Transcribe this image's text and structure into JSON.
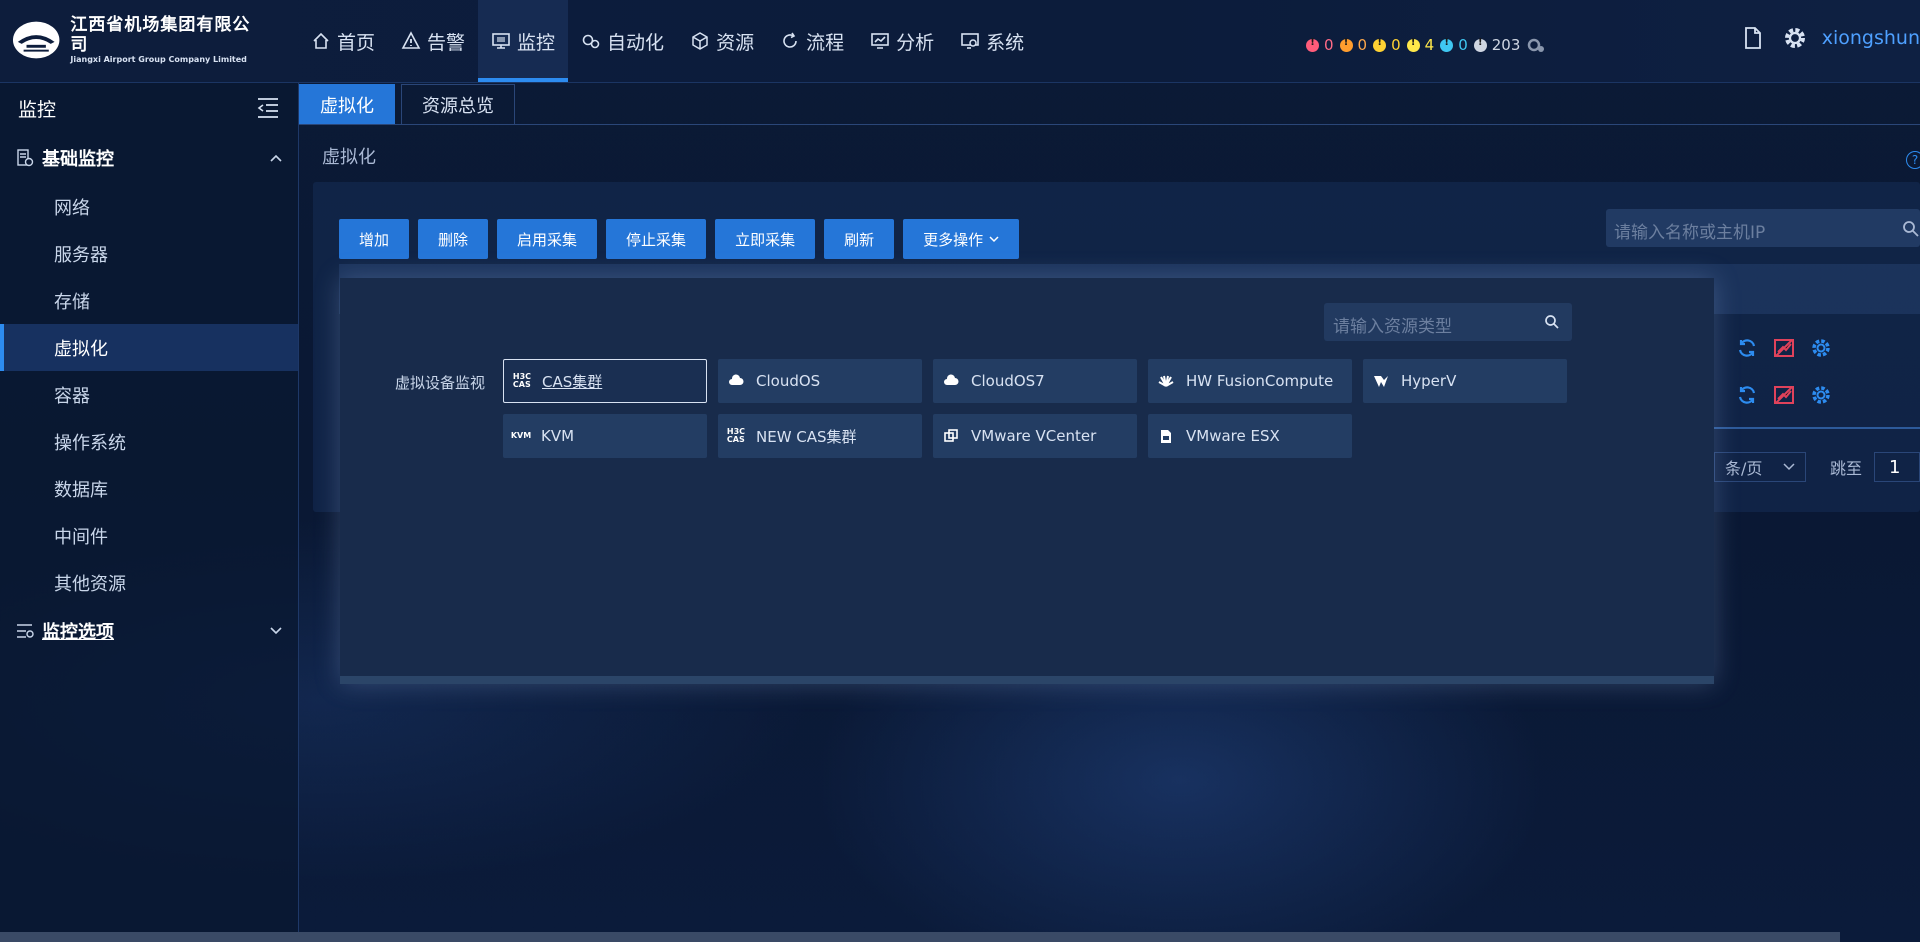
{
  "logo": {
    "cn": "江西省机场集团有限公司",
    "en": "Jiangxi Airport Group Company Limited"
  },
  "nav": [
    {
      "label": "首页",
      "icon": "home-icon"
    },
    {
      "label": "告警",
      "icon": "warning-icon"
    },
    {
      "label": "监控",
      "icon": "monitor-icon",
      "active": true
    },
    {
      "label": "自动化",
      "icon": "gears-icon"
    },
    {
      "label": "资源",
      "icon": "cube-icon"
    },
    {
      "label": "流程",
      "icon": "refresh-icon"
    },
    {
      "label": "分析",
      "icon": "chart-icon"
    },
    {
      "label": "系统",
      "icon": "settings-screen-icon"
    }
  ],
  "alerts": [
    {
      "count": "0",
      "color": "#ff5c7a"
    },
    {
      "count": "0",
      "color": "#ff9d2e"
    },
    {
      "count": "0",
      "color": "#ffd233"
    },
    {
      "count": "4",
      "color": "#ffe84a"
    },
    {
      "count": "0",
      "color": "#3fc8f2"
    },
    {
      "count": "203",
      "color": "#cfd6e2"
    }
  ],
  "user": {
    "name": "xiongshun"
  },
  "sidebar": {
    "title": "监控",
    "group1": "基础监控",
    "items": [
      "网络",
      "服务器",
      "存储",
      "虚拟化",
      "容器",
      "操作系统",
      "数据库",
      "中间件",
      "其他资源"
    ],
    "active_index": 3,
    "group2": "监控选项"
  },
  "tabs": [
    {
      "label": "虚拟化",
      "active": true
    },
    {
      "label": "资源总览",
      "active": false
    }
  ],
  "page": {
    "title": "虚拟化"
  },
  "toolbar": [
    "增加",
    "删除",
    "启用采集",
    "停止采集",
    "立即采集",
    "刷新",
    "更多操作"
  ],
  "search": {
    "placeholder": "请输入名称或主机IP"
  },
  "pager": {
    "per_page": "条/页",
    "jump": "跳至",
    "page": "1"
  },
  "modal": {
    "search_placeholder": "请输入资源类型",
    "category": "虚拟设备监视",
    "resources": [
      {
        "label": "CAS集群",
        "icon": "h3c-cas-icon",
        "selected": true
      },
      {
        "label": "CloudOS",
        "icon": "cloud-os-icon"
      },
      {
        "label": "CloudOS7",
        "icon": "cloud-os-icon"
      },
      {
        "label": "HW FusionCompute",
        "icon": "huawei-icon"
      },
      {
        "label": "HyperV",
        "icon": "hyperv-icon"
      },
      {
        "label": "KVM",
        "icon": "kvm-icon"
      },
      {
        "label": "NEW CAS集群",
        "icon": "h3c-cas-icon"
      },
      {
        "label": "VMware VCenter",
        "icon": "vmware-icon"
      },
      {
        "label": "VMware ESX",
        "icon": "esx-icon"
      }
    ]
  },
  "colors": {
    "accent": "#2576d8",
    "active_bg": "#173160",
    "background": "#0b1a36"
  }
}
